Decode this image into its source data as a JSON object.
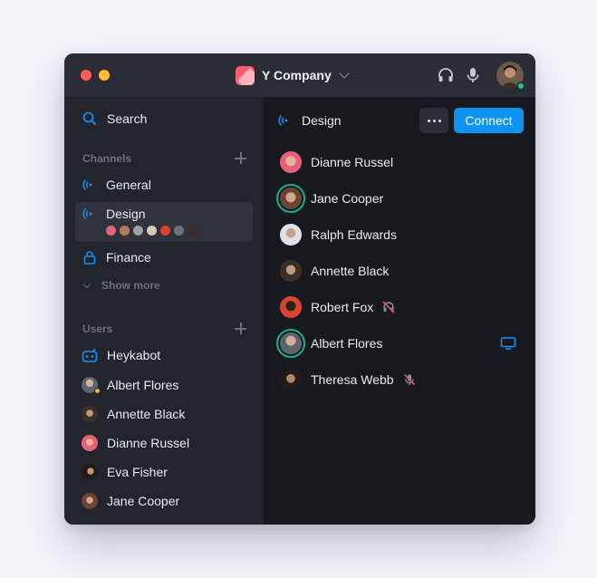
{
  "titlebar": {
    "company_name": "Y Company",
    "icons": [
      "headphones-icon",
      "microphone-icon"
    ],
    "user_status": "online"
  },
  "sidebar": {
    "search_label": "Search",
    "channels_title": "Channels",
    "channels": [
      {
        "label": "General",
        "icon": "broadcast-icon"
      },
      {
        "label": "Design",
        "icon": "broadcast-icon",
        "active": true
      },
      {
        "label": "Finance",
        "icon": "lock-icon"
      }
    ],
    "show_more_label": "Show more",
    "users_title": "Users",
    "users": [
      {
        "name": "Heykabot",
        "icon": "bot-icon"
      },
      {
        "name": "Albert Flores",
        "status": "away"
      },
      {
        "name": "Annette Black"
      },
      {
        "name": "Dianne Russel"
      },
      {
        "name": "Eva Fisher"
      },
      {
        "name": "Jane Cooper"
      }
    ]
  },
  "main": {
    "channel_title": "Design",
    "more_label": "More options",
    "connect_label": "Connect",
    "participants": [
      {
        "name": "Dianne Russel",
        "speaking": false
      },
      {
        "name": "Jane Cooper",
        "speaking": true
      },
      {
        "name": "Ralph Edwards",
        "speaking": false
      },
      {
        "name": "Annette Black",
        "speaking": false
      },
      {
        "name": "Robert Fox",
        "speaking": false,
        "icon": "headphones-off-icon"
      },
      {
        "name": "Albert Flores",
        "speaking": true,
        "icon": "screen-share-icon"
      },
      {
        "name": "Theresa Webb",
        "speaking": false,
        "icon": "microphone-off-icon"
      }
    ]
  },
  "colors": {
    "accent": "#0d93f2",
    "speaking_ring": "#15b383",
    "muted_icon": "#e0556b",
    "online": "#16c784",
    "away": "#f7b13c"
  }
}
